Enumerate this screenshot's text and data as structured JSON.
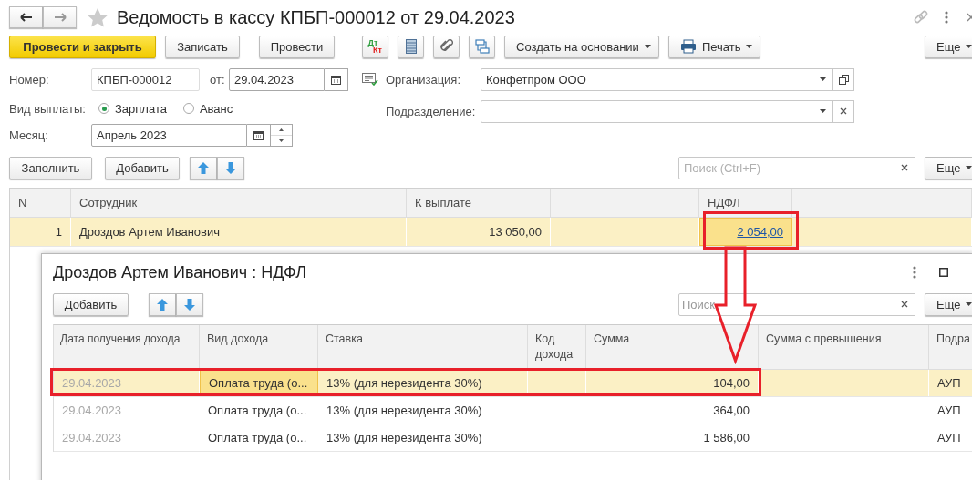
{
  "header": {
    "title": "Ведомость в кассу КПБП-000012 от 29.04.2023"
  },
  "toolbar": [
    {
      "kind": "primary",
      "label": "Провести и закрыть"
    },
    {
      "kind": "button",
      "label": "Записать"
    },
    {
      "kind": "button",
      "label": "Провести"
    },
    {
      "kind": "dtkt",
      "top": "Дт",
      "bottom": "Кт"
    },
    {
      "kind": "list"
    },
    {
      "kind": "clip"
    },
    {
      "kind": "structure"
    },
    {
      "kind": "menu",
      "label": "Создать на основании"
    },
    {
      "kind": "print",
      "label": "Печать"
    }
  ],
  "toolbar_more": "Еще",
  "number": {
    "label": "Номер:",
    "value": "КПБП-000012"
  },
  "date": {
    "label": "от:",
    "value": "29.04.2023"
  },
  "organization": {
    "label": "Организация:",
    "value": "Конфетпром ООО"
  },
  "payment_type": {
    "label": "Вид выплаты:",
    "options": [
      {
        "label": "Зарплата",
        "selected": true
      },
      {
        "label": "Аванс",
        "selected": false
      }
    ]
  },
  "department": {
    "label": "Подразделение:"
  },
  "month": {
    "label": "Месяц:",
    "value": "Апрель 2023"
  },
  "table_toolbar": {
    "buttons": [
      "Заполнить",
      "Добавить"
    ],
    "search_placeholder": "Поиск (Ctrl+F)",
    "more": "Еще"
  },
  "table": {
    "columns": [
      "N",
      "Сотрудник",
      "К выплате",
      "НДФЛ"
    ],
    "rows": [
      {
        "n": "1",
        "employee": "Дроздов Артем Иванович",
        "payout": "13 050,00",
        "ndfl": "2 054,00",
        "selected": true,
        "ndfl_focused": true
      }
    ]
  },
  "popup": {
    "title": "Дроздов Артем Иванович : НДФЛ",
    "add": "Добавить",
    "search_placeholder": "Поиск",
    "more": "Еще",
    "columns": [
      "Дата получения дохода",
      "Вид дохода",
      "Ставка",
      "Код дохода",
      "Сумма",
      "Сумма с превышения",
      "Подра"
    ],
    "rows": [
      {
        "date": "29.04.2023",
        "income_type": "Оплата труда (о...",
        "rate": "13% (для нерезидента 30%)",
        "amount": "104,00",
        "department": "АУП",
        "selected": true,
        "income_type_focused": true
      },
      {
        "date": "29.04.2023",
        "income_type": "Оплата труда (о...",
        "rate": "13% (для нерезидента 30%)",
        "amount": "364,00",
        "department": "АУП",
        "selected": false,
        "income_type_focused": false
      },
      {
        "date": "29.04.2023",
        "income_type": "Оплата труда (о...",
        "rate": "13% (для нерезидента 30%)",
        "amount": "1 586,00",
        "department": "АУП",
        "selected": false,
        "income_type_focused": false
      }
    ]
  }
}
